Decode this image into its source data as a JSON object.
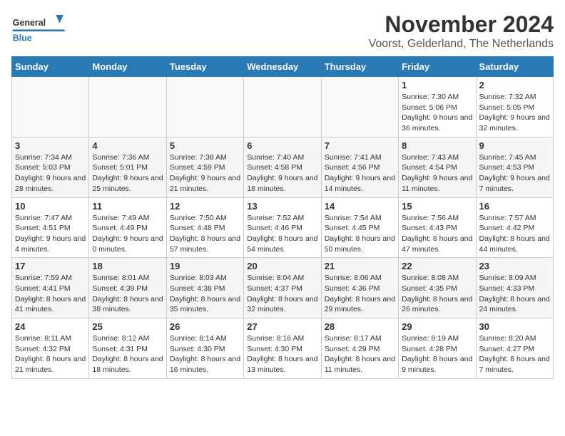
{
  "header": {
    "logo_general": "General",
    "logo_blue": "Blue",
    "title": "November 2024",
    "subtitle": "Voorst, Gelderland, The Netherlands"
  },
  "calendar": {
    "days_of_week": [
      "Sunday",
      "Monday",
      "Tuesday",
      "Wednesday",
      "Thursday",
      "Friday",
      "Saturday"
    ],
    "weeks": [
      [
        {
          "day": "",
          "info": ""
        },
        {
          "day": "",
          "info": ""
        },
        {
          "day": "",
          "info": ""
        },
        {
          "day": "",
          "info": ""
        },
        {
          "day": "",
          "info": ""
        },
        {
          "day": "1",
          "info": "Sunrise: 7:30 AM\nSunset: 5:06 PM\nDaylight: 9 hours and 36 minutes."
        },
        {
          "day": "2",
          "info": "Sunrise: 7:32 AM\nSunset: 5:05 PM\nDaylight: 9 hours and 32 minutes."
        }
      ],
      [
        {
          "day": "3",
          "info": "Sunrise: 7:34 AM\nSunset: 5:03 PM\nDaylight: 9 hours and 28 minutes."
        },
        {
          "day": "4",
          "info": "Sunrise: 7:36 AM\nSunset: 5:01 PM\nDaylight: 9 hours and 25 minutes."
        },
        {
          "day": "5",
          "info": "Sunrise: 7:38 AM\nSunset: 4:59 PM\nDaylight: 9 hours and 21 minutes."
        },
        {
          "day": "6",
          "info": "Sunrise: 7:40 AM\nSunset: 4:58 PM\nDaylight: 9 hours and 18 minutes."
        },
        {
          "day": "7",
          "info": "Sunrise: 7:41 AM\nSunset: 4:56 PM\nDaylight: 9 hours and 14 minutes."
        },
        {
          "day": "8",
          "info": "Sunrise: 7:43 AM\nSunset: 4:54 PM\nDaylight: 9 hours and 11 minutes."
        },
        {
          "day": "9",
          "info": "Sunrise: 7:45 AM\nSunset: 4:53 PM\nDaylight: 9 hours and 7 minutes."
        }
      ],
      [
        {
          "day": "10",
          "info": "Sunrise: 7:47 AM\nSunset: 4:51 PM\nDaylight: 9 hours and 4 minutes."
        },
        {
          "day": "11",
          "info": "Sunrise: 7:49 AM\nSunset: 4:49 PM\nDaylight: 9 hours and 0 minutes."
        },
        {
          "day": "12",
          "info": "Sunrise: 7:50 AM\nSunset: 4:48 PM\nDaylight: 8 hours and 57 minutes."
        },
        {
          "day": "13",
          "info": "Sunrise: 7:52 AM\nSunset: 4:46 PM\nDaylight: 8 hours and 54 minutes."
        },
        {
          "day": "14",
          "info": "Sunrise: 7:54 AM\nSunset: 4:45 PM\nDaylight: 8 hours and 50 minutes."
        },
        {
          "day": "15",
          "info": "Sunrise: 7:56 AM\nSunset: 4:43 PM\nDaylight: 8 hours and 47 minutes."
        },
        {
          "day": "16",
          "info": "Sunrise: 7:57 AM\nSunset: 4:42 PM\nDaylight: 8 hours and 44 minutes."
        }
      ],
      [
        {
          "day": "17",
          "info": "Sunrise: 7:59 AM\nSunset: 4:41 PM\nDaylight: 8 hours and 41 minutes."
        },
        {
          "day": "18",
          "info": "Sunrise: 8:01 AM\nSunset: 4:39 PM\nDaylight: 8 hours and 38 minutes."
        },
        {
          "day": "19",
          "info": "Sunrise: 8:03 AM\nSunset: 4:38 PM\nDaylight: 8 hours and 35 minutes."
        },
        {
          "day": "20",
          "info": "Sunrise: 8:04 AM\nSunset: 4:37 PM\nDaylight: 8 hours and 32 minutes."
        },
        {
          "day": "21",
          "info": "Sunrise: 8:06 AM\nSunset: 4:36 PM\nDaylight: 8 hours and 29 minutes."
        },
        {
          "day": "22",
          "info": "Sunrise: 8:08 AM\nSunset: 4:35 PM\nDaylight: 8 hours and 26 minutes."
        },
        {
          "day": "23",
          "info": "Sunrise: 8:09 AM\nSunset: 4:33 PM\nDaylight: 8 hours and 24 minutes."
        }
      ],
      [
        {
          "day": "24",
          "info": "Sunrise: 8:11 AM\nSunset: 4:32 PM\nDaylight: 8 hours and 21 minutes."
        },
        {
          "day": "25",
          "info": "Sunrise: 8:12 AM\nSunset: 4:31 PM\nDaylight: 8 hours and 18 minutes."
        },
        {
          "day": "26",
          "info": "Sunrise: 8:14 AM\nSunset: 4:30 PM\nDaylight: 8 hours and 16 minutes."
        },
        {
          "day": "27",
          "info": "Sunrise: 8:16 AM\nSunset: 4:30 PM\nDaylight: 8 hours and 13 minutes."
        },
        {
          "day": "28",
          "info": "Sunrise: 8:17 AM\nSunset: 4:29 PM\nDaylight: 8 hours and 11 minutes."
        },
        {
          "day": "29",
          "info": "Sunrise: 8:19 AM\nSunset: 4:28 PM\nDaylight: 8 hours and 9 minutes."
        },
        {
          "day": "30",
          "info": "Sunrise: 8:20 AM\nSunset: 4:27 PM\nDaylight: 8 hours and 7 minutes."
        }
      ]
    ]
  }
}
